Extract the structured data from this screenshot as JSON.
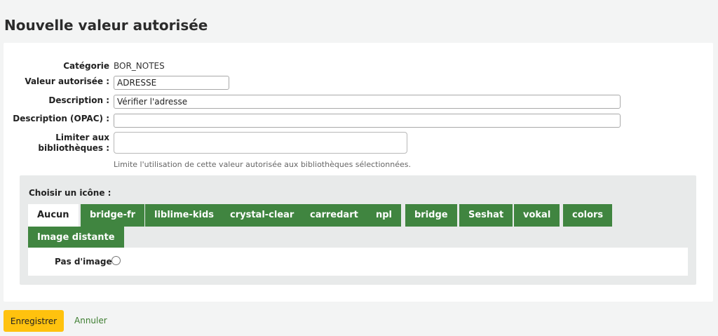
{
  "page_title": "Nouvelle valeur autorisée",
  "form": {
    "category": {
      "label": "Catégorie",
      "value": "BOR_NOTES"
    },
    "authorized_value": {
      "label": "Valeur autorisée :",
      "value": "ADRESSE"
    },
    "description": {
      "label": "Description :",
      "value": "Vérifier l'adresse"
    },
    "description_opac": {
      "label": "Description (OPAC) :",
      "value": ""
    },
    "branches": {
      "label_line1": "Limiter aux",
      "label_line2": "bibliothèques :",
      "hint": "Limite l'utilisation de cette valeur autorisée aux bibliothèques sélectionnées."
    }
  },
  "icons": {
    "title": "Choisir un icône :",
    "tabs": [
      "Aucun",
      "bridge-fr",
      "liblime-kids",
      "crystal-clear",
      "carredart",
      "npl",
      "bridge",
      "Seshat",
      "vokal",
      "colors",
      "Image distante"
    ],
    "active_tab": "Aucun",
    "no_image_label": "Pas d'image :"
  },
  "actions": {
    "save": "Enregistrer",
    "cancel": "Annuler"
  },
  "colors": {
    "tab_green": "#408540",
    "save_yellow": "#ffc20e",
    "link_green": "#3d7d30"
  }
}
